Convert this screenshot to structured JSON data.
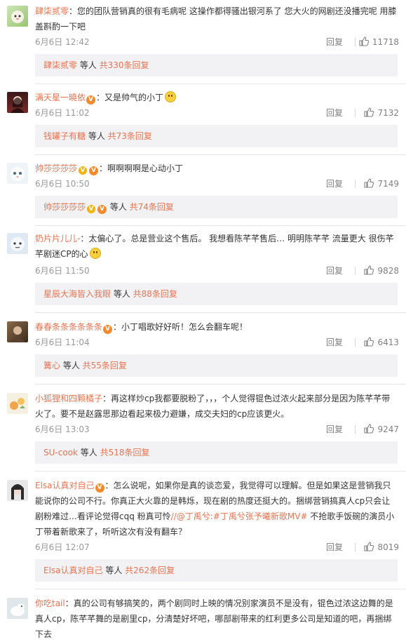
{
  "comments": [
    {
      "username": "肆柒贰零",
      "text": "：您的团队营销真的很有毛病呢 这操作都得骚出银河系了 您大火的网剧还没播完呢 用膝盖斟酌一下吧",
      "time": "6月6日 12:42",
      "reply": "回复",
      "likes": "11718",
      "sub_user": "肆柒贰零",
      "sub_mid": " 等人 ",
      "sub_total": "共330条回复"
    },
    {
      "username": "满天星一曉依",
      "text": "：又是帅气的小丁",
      "time": "6月6日 11:02",
      "reply": "回复",
      "likes": "7132",
      "sub_user": "钱罐子有糖",
      "sub_mid": " 等人 ",
      "sub_total": "共73条回复"
    },
    {
      "username": "帅莎莎莎莎",
      "text": "：啊啊啊啊是心动小丁",
      "time": "6月6日 10:50",
      "reply": "回复",
      "likes": "7149",
      "sub_user": "帅莎莎莎莎",
      "sub_mid": " 等人 ",
      "sub_total": "共74条回复"
    },
    {
      "username": "奶片片儿儿-",
      "text": "：太偏心了。总是营业这个售后。 我想看陈芊芊售后…     明明陈芊芊 流量更大 很伤芊芊剧迷CP的心",
      "time": "6月6日 11:50",
      "reply": "回复",
      "likes": "9828",
      "sub_user": "星辰大海皆入我眼",
      "sub_mid": " 等人 ",
      "sub_total": "共88条回复"
    },
    {
      "username": "春春条条条条条条",
      "text": "：小丁唱歌好好听！怎么会翻车呢！",
      "time": "6月6日 11:04",
      "reply": "回复",
      "likes": "6413",
      "sub_user": "篝心",
      "sub_mid": " 等人 ",
      "sub_total": "共55条回复"
    },
    {
      "username": "小狐狸和四颗橘子",
      "text": "：再这样炒cp我都要脱粉了，，，个人觉得锟色过浓火起来部分是因为陈芊芊带火了。要不是赵露思那边看起来极力避嫌，成交夫妇的cp应该更火。",
      "time": "6月6日 13:03",
      "reply": "回复",
      "likes": "9247",
      "sub_user": "SU-cook",
      "sub_mid": " 等人 ",
      "sub_total": "共518条回复"
    },
    {
      "username": "Elsa认真对自己",
      "text_a": "：怎么说呢，如果你是真的谈恋爱，我觉得可以理解。但是如果这是营销我只能说你的公司不行。你真正大火靠的是韩烁，现在剧的热度还挺大的。捆绑营销搞真人cp只会让剧粉难过…看评论觉得cqq 粉真可怜",
      "text_link": "//@丁禹兮:#丁禹兮张予曦新歌MV#",
      "text_b": " 不抢歌手饭碗的演员小丁带着新歌来了，听听这次有没有翻车？",
      "time": "6月6日 12:07",
      "reply": "回复",
      "likes": "8019",
      "sub_user": "Elsa认真对自己",
      "sub_mid": " 等人 ",
      "sub_total": "共262条回复"
    },
    {
      "username": "你吃tail",
      "text": "：真的公司有够搞笑的，两个剧同时上映的情况别家演员不是没有，锟色过浓这边舞的是真人cp，陈芊芊舞的是剧里cp，分清楚好坏吧，哪部剧带来的红利更多公司是知道的吧，再捆绑下去"
    }
  ]
}
